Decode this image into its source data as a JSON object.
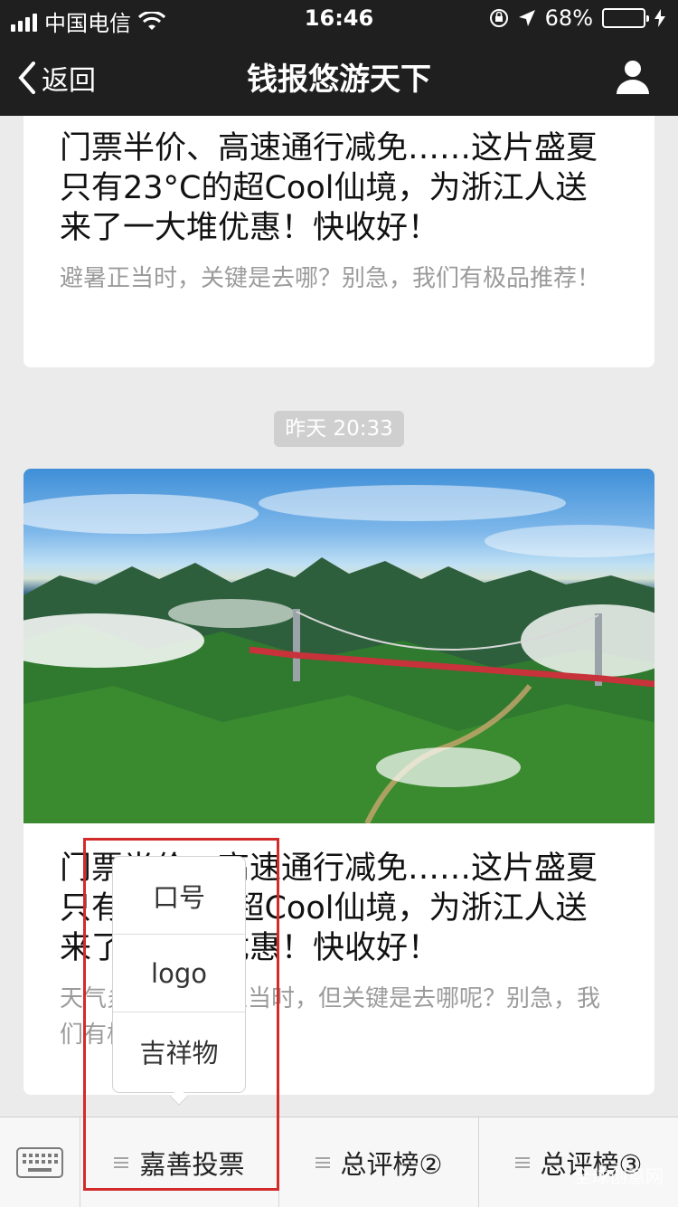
{
  "status_bar": {
    "carrier": "中国电信",
    "time": "16:46",
    "battery_percent": "68%",
    "battery_level": 0.68,
    "icons": [
      "signal-icon",
      "wifi-icon",
      "orientation-lock-icon",
      "location-icon",
      "battery-icon",
      "charging-icon"
    ]
  },
  "nav": {
    "back_label": "返回",
    "title": "钱报悠游天下",
    "user_icon": "user-icon"
  },
  "articles": [
    {
      "title": "门票半价、高速通行减免……这片盛夏只有23°C的超Cool仙境，为浙江人送来了一大堆优惠！快收好！",
      "desc": "避暑正当时，关键是去哪？别急，我们有极品推荐！"
    },
    {
      "title": "门票半价、高速通行减免……这片盛夏只有23°C的超Cool仙境，为浙江人送来了一大堆优惠！快收好！",
      "desc": "天气炎热，避暑正当时，但关键是去哪呢？别急，我们有极品推荐！",
      "image": "mountain-bridge-photo"
    }
  ],
  "timestamp": "昨天 20:33",
  "menu": {
    "keyboard_icon": "keyboard-icon",
    "items": [
      {
        "label": "嘉善投票"
      },
      {
        "label": "总评榜②"
      },
      {
        "label": "总评榜③"
      }
    ],
    "submenu": [
      "口号",
      "logo",
      "吉祥物"
    ]
  },
  "watermark": "全球创意网",
  "colors": {
    "nav_bg": "#1f1f1f",
    "highlight": "#d32a2a",
    "battery": "#4cd964"
  }
}
